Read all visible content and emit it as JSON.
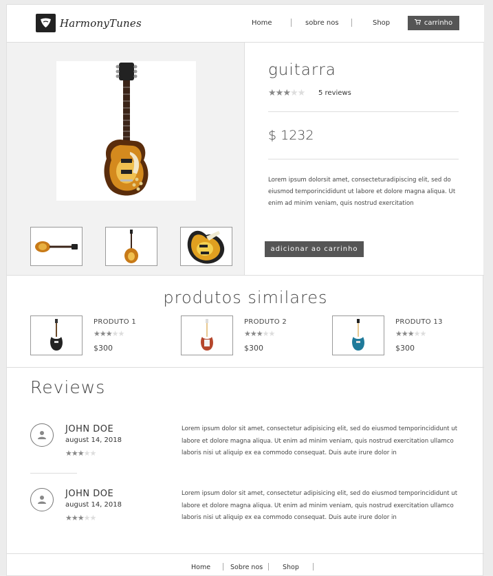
{
  "header": {
    "logo_text": "HarmonyTunes",
    "nav": [
      {
        "label": "Home"
      },
      {
        "label": "sobre nos"
      },
      {
        "label": "Shop"
      }
    ],
    "cart_label": "carrinho"
  },
  "product": {
    "title": "guitarra",
    "rating": 3,
    "rating_max": 5,
    "reviews_label": "5 reviews",
    "price": "$ 1232",
    "description": "Lorem ipsum dolorsit amet, consecteturadipiscing elit, sed do eiusmod temporincididunt ut labore et dolore magna aliqua. Ut enim ad minim veniam, quis nostrud exercitation",
    "add_to_cart_label": "adicionar ao carrinho"
  },
  "similar": {
    "title": "produtos similares",
    "items": [
      {
        "name": "PRODUTO 1",
        "rating": 3,
        "price": "$300",
        "color": "#222222"
      },
      {
        "name": "PRODUTO 2",
        "rating": 3,
        "price": "$300",
        "color": "#b5462c"
      },
      {
        "name": "PRODUTO 13",
        "rating": 3,
        "price": "$300",
        "color": "#1f7a9a"
      }
    ]
  },
  "reviews": {
    "title": "Reviews",
    "items": [
      {
        "name": "JOHN DOE",
        "date": "august 14, 2018",
        "rating": 3,
        "text": "Lorem ipsum dolor sit amet, consectetur adipisicing elit, sed do eiusmod temporincididunt ut labore et dolore magna aliqua. Ut enim ad minim veniam, quis nostrud exercitation ullamco laboris nisi ut aliquip ex ea commodo consequat. Duis aute irure dolor in"
      },
      {
        "name": "JOHN DOE",
        "date": "august 14, 2018",
        "rating": 3,
        "text": "Lorem ipsum dolor sit amet, consectetur adipisicing elit, sed do eiusmod temporincididunt ut labore et dolore magna aliqua. Ut enim ad minim veniam, quis nostrud exercitation ullamco laboris nisi ut aliquip ex ea commodo consequat. Duis aute irure dolor in"
      }
    ]
  },
  "footer": {
    "links": [
      {
        "label": "Home"
      },
      {
        "label": "Sobre nos"
      },
      {
        "label": "Shop"
      }
    ]
  },
  "colors": {
    "button_bg": "#555555",
    "star_on": "#888888",
    "star_off": "#dddddd"
  }
}
